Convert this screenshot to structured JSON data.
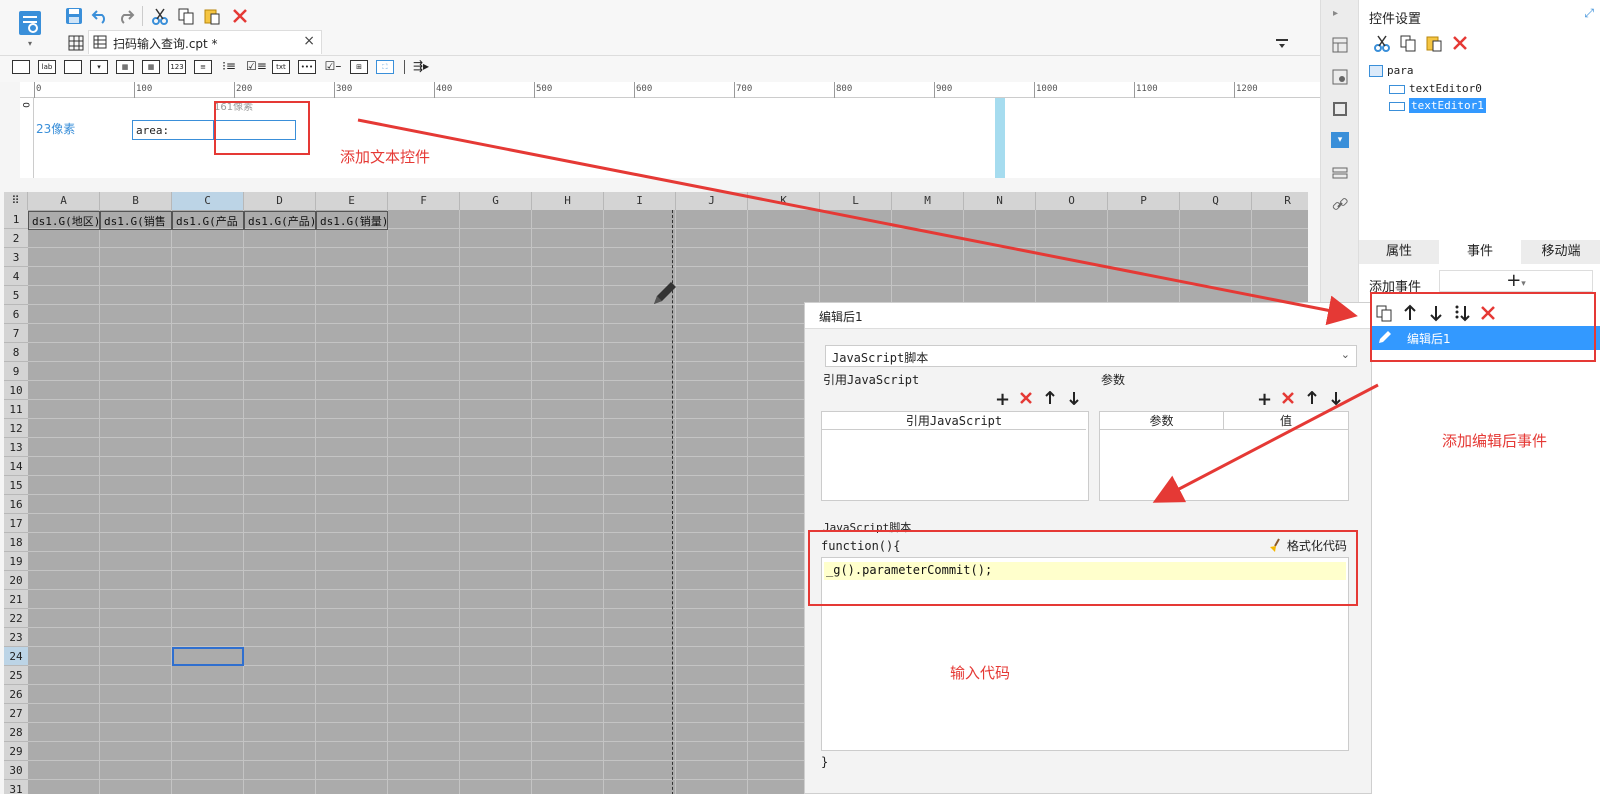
{
  "toolbar": {
    "tab_title": "扫码输入查询.cpt *",
    "tab_close": "×"
  },
  "ruler": {
    "ticks": [
      "0",
      "100",
      "200",
      "300",
      "400",
      "500",
      "600",
      "700",
      "800",
      "900",
      "1000",
      "1100",
      "1200"
    ],
    "vertical_label": "0"
  },
  "param_area": {
    "height_label": "23像素",
    "width_label": "161像素",
    "area_label": "area:"
  },
  "grid": {
    "columns": [
      "A",
      "B",
      "C",
      "D",
      "E",
      "F",
      "G",
      "H",
      "I",
      "J",
      "K",
      "L",
      "M",
      "N",
      "O",
      "P",
      "Q",
      "R"
    ],
    "rows": [
      "1",
      "2",
      "3",
      "4",
      "5",
      "6",
      "7",
      "8",
      "9",
      "10",
      "11",
      "12",
      "13",
      "14",
      "15",
      "16",
      "17",
      "18",
      "19",
      "20",
      "21",
      "22",
      "23",
      "24",
      "25",
      "26",
      "27",
      "28",
      "29",
      "30",
      "31"
    ],
    "row1_cells": [
      "ds1.G(地区)",
      "ds1.G(销售",
      "ds1.G(产品",
      "ds1.G(产品)",
      "ds1.G(销量)"
    ]
  },
  "right_panel": {
    "title": "控件设置",
    "tree": {
      "root": "para",
      "children": [
        "textEditor0",
        "textEditor1"
      ],
      "selected": "textEditor1"
    },
    "tabs": [
      "属性",
      "事件",
      "移动端"
    ],
    "active_tab": "事件",
    "add_event_label": "添加事件",
    "add_event_button": "+",
    "event_item": "编辑后1"
  },
  "dialog": {
    "title": "编辑后1",
    "script_type": "JavaScript脚本",
    "ref_js_label": "引用JavaScript",
    "params_label": "参数",
    "ref_js_header": "引用JavaScript",
    "params_header": "参数",
    "value_header": "值",
    "script_section_label": "JavaScript脚本",
    "function_header": "function(){",
    "format_button": "格式化代码",
    "code": "_g().parameterCommit();",
    "closing_brace": "}"
  },
  "annotations": {
    "add_text_widget": "添加文本控件",
    "add_after_edit_event": "添加编辑后事件",
    "input_code": "输入代码"
  },
  "colors": {
    "accent": "#3a8fd9",
    "annotation_red": "#e53935",
    "selection_blue": "#3399ff",
    "highlight_yellow": "#ffffcc"
  }
}
